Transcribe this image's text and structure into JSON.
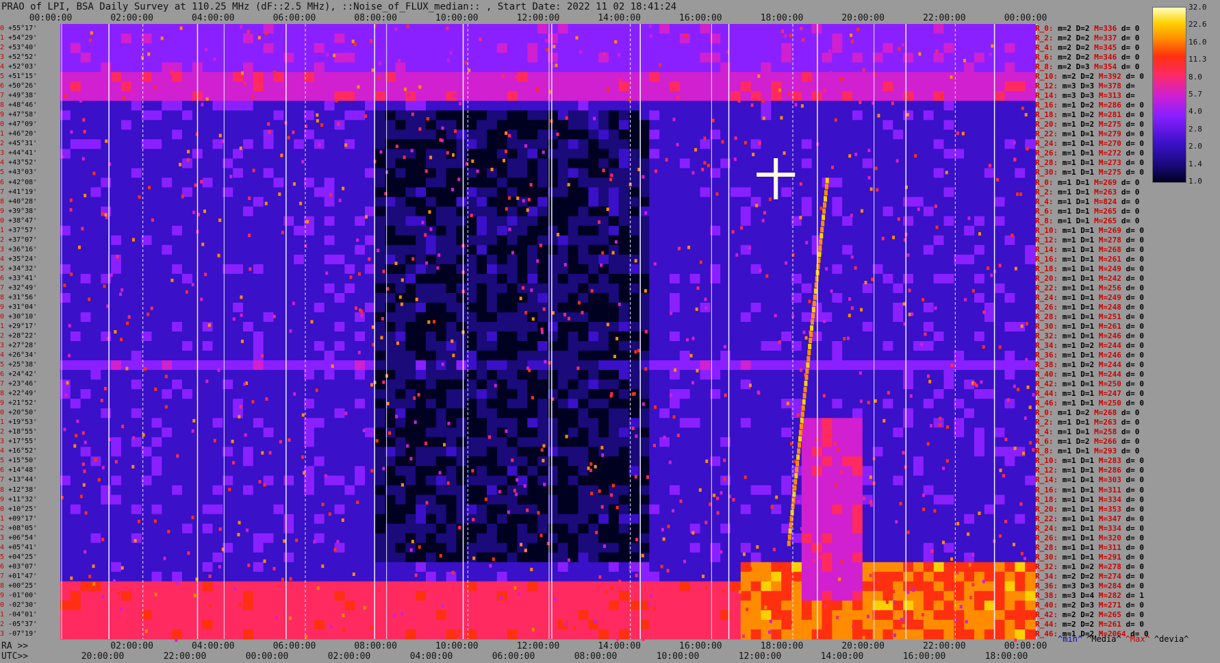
{
  "title": "PRAO of LPI, BSA Daily Survey at 110.25 MHz (dF::2.5 MHz), ::Noise_of_FLUX_median:: , Start Date: 2022 11 02 18:41:24",
  "chart_data": {
    "type": "heatmap",
    "top_axis_ticks": [
      "00:00:00",
      "02:00:00",
      "04:00:00",
      "06:00:00",
      "08:00:00",
      "10:00:00",
      "12:00:00",
      "14:00:00",
      "16:00:00",
      "18:00:00",
      "20:00:00",
      "22:00:00",
      "00:00:00"
    ],
    "ra_label": "RA >>",
    "ra_ticks": [
      "00:00:00",
      "02:00:00",
      "04:00:00",
      "06:00:00",
      "08:00:00",
      "10:00:00",
      "12:00:00",
      "14:00:00",
      "16:00:00",
      "18:00:00",
      "20:00:00",
      "22:00:00",
      "00:00:00"
    ],
    "utc_label": "UTC>>",
    "utc_ticks": [
      "20:00:00",
      "22:00:00",
      "00:00:00",
      "02:00:00",
      "04:00:00",
      "06:00:00",
      "08:00:00",
      "10:00:00",
      "12:00:00",
      "14:00:00",
      "16:00:00",
      "18:00:00"
    ],
    "colorbar_ticks": [
      "32.0",
      "22.6",
      "16.0",
      "11.3",
      "8.0",
      "5.7",
      "4.0",
      "2.8",
      "2.0",
      "1.4",
      "1.0"
    ],
    "colormap": [
      "#000020",
      "#1a0a7a",
      "#3a10c8",
      "#8a20ff",
      "#d020d0",
      "#ff2a60",
      "#ff3010",
      "#ff8c00",
      "#ffd000",
      "#ffffc0"
    ],
    "declinations": [
      "+55°17'",
      "+54°29'",
      "+53°40'",
      "+52°52'",
      "+52°03'",
      "+51°15'",
      "+50°26'",
      "+49°38'",
      "+48°46'",
      "+47°58'",
      "+47°09'",
      "+46°20'",
      "+45°31'",
      "+44°41'",
      "+43°52'",
      "+43°03'",
      "+42°08'",
      "+41°19'",
      "+40°28'",
      "+39°38'",
      "+38°47'",
      "+37°57'",
      "+37°07'",
      "+36°16'",
      "+35°24'",
      "+34°32'",
      "+33°41'",
      "+32°49'",
      "+31°56'",
      "+31°04'",
      "+30°10'",
      "+29°17'",
      "+28°22'",
      "+27°28'",
      "+26°34'",
      "+25°38'",
      "+24°42'",
      "+23°46'",
      "+22°49'",
      "+21°52'",
      "+20°50'",
      "+19°53'",
      "+18°55'",
      "+17°55'",
      "+16°52'",
      "+15°50'",
      "+14°48'",
      "+13°44'",
      "+12°38'",
      "+11°32'",
      "+10°25'",
      "+09°17'",
      "+08°05'",
      "+06°54'",
      "+05°41'",
      "+04°25'",
      "+03°07'",
      "+01°47'",
      "+00°25'",
      "-01°00'",
      "-02°30'",
      "-04°01'",
      "-05°37'",
      "-07°19'"
    ],
    "row_stats": [
      [
        "R_0:",
        "m=2",
        "D=2",
        "M=336",
        "d= 0"
      ],
      [
        "R_2:",
        "m=2",
        "D=2",
        "M=337",
        "d= 0"
      ],
      [
        "R_4:",
        "m=2",
        "D=2",
        "M=345",
        "d= 0"
      ],
      [
        "R_6:",
        "m=2",
        "D=2",
        "M=346",
        "d= 0"
      ],
      [
        "R_8:",
        "m=2",
        "D=3",
        "M=354",
        "d= 0"
      ],
      [
        "R_10:",
        "m=2",
        "D=2",
        "M=392",
        "d= 0"
      ],
      [
        "R_12:",
        "m=3",
        "D=3",
        "M=378",
        "d="
      ],
      [
        "R_14:",
        "m=3",
        "D=3",
        "M=313",
        "d="
      ],
      [
        "R_16:",
        "m=1",
        "D=2",
        "M=286",
        "d= 0"
      ],
      [
        "R_18:",
        "m=1",
        "D=2",
        "M=281",
        "d= 0"
      ],
      [
        "R_20:",
        "m=1",
        "D=2",
        "M=275",
        "d= 0"
      ],
      [
        "R_22:",
        "m=1",
        "D=1",
        "M=279",
        "d= 0"
      ],
      [
        "R_24:",
        "m=1",
        "D=1",
        "M=270",
        "d= 0"
      ],
      [
        "R_26:",
        "m=1",
        "D=1",
        "M=272",
        "d= 0"
      ],
      [
        "R_28:",
        "m=1",
        "D=1",
        "M=273",
        "d= 0"
      ],
      [
        "R_30:",
        "m=1",
        "D=1",
        "M=275",
        "d= 0"
      ],
      [
        "R_0:",
        "m=1",
        "D=1",
        "M=269",
        "d= 0"
      ],
      [
        "R_2:",
        "m=1",
        "D=1",
        "M=263",
        "d= 0"
      ],
      [
        "R_4:",
        "m=1",
        "D=1",
        "M=824",
        "d= 0"
      ],
      [
        "R_6:",
        "m=1",
        "D=1",
        "M=265",
        "d= 0"
      ],
      [
        "R_8:",
        "m=1",
        "D=1",
        "M=265",
        "d= 0"
      ],
      [
        "R_10:",
        "m=1",
        "D=1",
        "M=269",
        "d= 0"
      ],
      [
        "R_12:",
        "m=1",
        "D=1",
        "M=278",
        "d= 0"
      ],
      [
        "R_14:",
        "m=1",
        "D=1",
        "M=268",
        "d= 0"
      ],
      [
        "R_16:",
        "m=1",
        "D=1",
        "M=261",
        "d= 0"
      ],
      [
        "R_18:",
        "m=1",
        "D=1",
        "M=249",
        "d= 0"
      ],
      [
        "R_20:",
        "m=1",
        "D=1",
        "M=242",
        "d= 0"
      ],
      [
        "R_22:",
        "m=1",
        "D=1",
        "M=256",
        "d= 0"
      ],
      [
        "R_24:",
        "m=1",
        "D=1",
        "M=249",
        "d= 0"
      ],
      [
        "R_26:",
        "m=1",
        "D=1",
        "M=248",
        "d= 0"
      ],
      [
        "R_28:",
        "m=1",
        "D=1",
        "M=251",
        "d= 0"
      ],
      [
        "R_30:",
        "m=1",
        "D=1",
        "M=261",
        "d= 0"
      ],
      [
        "R_32:",
        "m=1",
        "D=1",
        "M=246",
        "d= 0"
      ],
      [
        "R_34:",
        "m=1",
        "D=2",
        "M=244",
        "d= 0"
      ],
      [
        "R_36:",
        "m=1",
        "D=1",
        "M=246",
        "d= 0"
      ],
      [
        "R_38:",
        "m=1",
        "D=2",
        "M=244",
        "d= 0"
      ],
      [
        "R_40:",
        "m=1",
        "D=1",
        "M=244",
        "d= 0"
      ],
      [
        "R_42:",
        "m=1",
        "D=1",
        "M=250",
        "d= 0"
      ],
      [
        "R_44:",
        "m=1",
        "D=1",
        "M=247",
        "d= 0"
      ],
      [
        "R_46:",
        "m=1",
        "D=1",
        "M=250",
        "d= 0"
      ],
      [
        "R_0:",
        "m=1",
        "D=2",
        "M=268",
        "d= 0"
      ],
      [
        "R_2:",
        "m=1",
        "D=1",
        "M=263",
        "d= 0"
      ],
      [
        "R_4:",
        "m=1",
        "D=1",
        "M=258",
        "d= 0"
      ],
      [
        "R_6:",
        "m=1",
        "D=2",
        "M=266",
        "d= 0"
      ],
      [
        "R_8:",
        "m=1",
        "D=1",
        "M=293",
        "d= 0"
      ],
      [
        "R_10:",
        "m=1",
        "D=1",
        "M=283",
        "d= 0"
      ],
      [
        "R_12:",
        "m=1",
        "D=1",
        "M=286",
        "d= 0"
      ],
      [
        "R_14:",
        "m=1",
        "D=1",
        "M=303",
        "d= 0"
      ],
      [
        "R_16:",
        "m=1",
        "D=1",
        "M=311",
        "d= 0"
      ],
      [
        "R_18:",
        "m=1",
        "D=1",
        "M=334",
        "d= 0"
      ],
      [
        "R_20:",
        "m=1",
        "D=1",
        "M=353",
        "d= 0"
      ],
      [
        "R_22:",
        "m=1",
        "D=1",
        "M=347",
        "d= 0"
      ],
      [
        "R_24:",
        "m=1",
        "D=1",
        "M=334",
        "d= 0"
      ],
      [
        "R_26:",
        "m=1",
        "D=1",
        "M=320",
        "d= 0"
      ],
      [
        "R_28:",
        "m=1",
        "D=1",
        "M=311",
        "d= 0"
      ],
      [
        "R_30:",
        "m=1",
        "D=1",
        "M=291",
        "d= 0"
      ],
      [
        "R_32:",
        "m=1",
        "D=2",
        "M=278",
        "d= 0"
      ],
      [
        "R_34:",
        "m=2",
        "D=2",
        "M=274",
        "d= 0"
      ],
      [
        "R_36:",
        "m=3",
        "D=3",
        "M=284",
        "d= 0"
      ],
      [
        "R_38:",
        "m=3",
        "D=4",
        "M=282",
        "d= 1"
      ],
      [
        "R_40:",
        "m=2",
        "D=3",
        "M=271",
        "d= 0"
      ],
      [
        "R_42:",
        "m=2",
        "D=2",
        "M=265",
        "d= 0"
      ],
      [
        "R_44:",
        "m=2",
        "D=2",
        "M=261",
        "d= 0"
      ],
      [
        "R_46:",
        "m=1",
        "D=2",
        "M=2064",
        "d= 0"
      ]
    ],
    "legend": [
      "^min^",
      "^Media^",
      "^Max^",
      "^devia^"
    ]
  }
}
